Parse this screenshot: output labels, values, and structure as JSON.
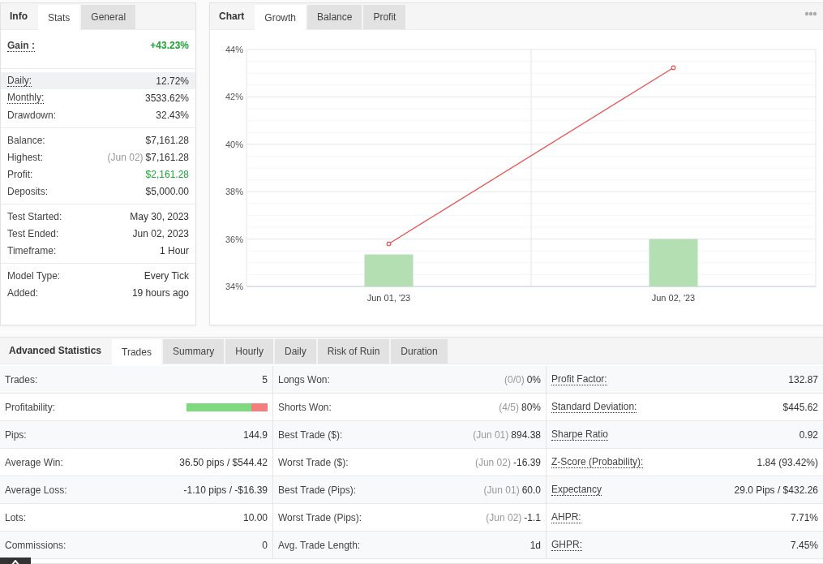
{
  "stats_panel": {
    "header": "Info",
    "tabs": [
      {
        "label": "Stats",
        "selected": true
      },
      {
        "label": "General",
        "selected": false
      }
    ],
    "groups": [
      {
        "rows": [
          {
            "label": "Gain :",
            "value": "+43.23%",
            "positive": true,
            "underlined": true,
            "highlighted": false,
            "bold": true
          }
        ]
      },
      {
        "rows": [
          {
            "label": "Daily:",
            "value": "12.72%",
            "positive": false,
            "underlined": true,
            "highlighted": true,
            "bold": false
          },
          {
            "label": "Monthly:",
            "value": "3533.62%",
            "positive": false,
            "underlined": true,
            "highlighted": false,
            "bold": false
          },
          {
            "label": "Drawdown:",
            "value": "32.43%",
            "positive": false,
            "underlined": false,
            "highlighted": false,
            "bold": false
          }
        ]
      },
      {
        "rows": [
          {
            "label": "Balance:",
            "value": "$7,161.28",
            "positive": false,
            "underlined": false,
            "highlighted": false,
            "bold": false
          },
          {
            "label": "Highest:",
            "note": "(Jun 02)",
            "value": "$7,161.28",
            "positive": false,
            "underlined": false,
            "highlighted": false,
            "bold": false
          },
          {
            "label": "Profit:",
            "value": "$2,161.28",
            "positive": true,
            "underlined": false,
            "highlighted": false,
            "bold": false
          },
          {
            "label": "Deposits:",
            "value": "$5,000.00",
            "positive": false,
            "underlined": false,
            "highlighted": false,
            "bold": false
          }
        ]
      },
      {
        "rows": [
          {
            "label": "Test Started:",
            "value": "May 30, 2023",
            "positive": false,
            "underlined": false,
            "highlighted": false,
            "bold": false
          },
          {
            "label": "Test Ended:",
            "value": "Jun 02, 2023",
            "positive": false,
            "underlined": false,
            "highlighted": false,
            "bold": false
          },
          {
            "label": "Timeframe:",
            "value": "1 Hour",
            "positive": false,
            "underlined": false,
            "highlighted": false,
            "bold": false
          }
        ]
      },
      {
        "rows": [
          {
            "label": "Model Type:",
            "value": "Every Tick",
            "positive": false,
            "underlined": false,
            "highlighted": false,
            "bold": false
          },
          {
            "label": "Added:",
            "value": "19 hours ago",
            "positive": false,
            "underlined": false,
            "highlighted": false,
            "bold": false
          }
        ]
      }
    ]
  },
  "chart_panel": {
    "header": "Chart",
    "tabs": [
      {
        "label": "Growth",
        "selected": true
      },
      {
        "label": "Balance",
        "selected": false
      },
      {
        "label": "Profit",
        "selected": false
      }
    ],
    "chart_data": {
      "type": "bar",
      "grid": true,
      "categories": [
        "Jun 01, '23",
        "Jun 02, '23"
      ],
      "ylim": [
        34,
        44
      ],
      "yticks": [
        {
          "value": 34,
          "label": "34%"
        },
        {
          "value": 36,
          "label": "36%"
        },
        {
          "value": 38,
          "label": "38%"
        },
        {
          "value": 40,
          "label": "40%"
        },
        {
          "value": 42,
          "label": "42%"
        },
        {
          "value": 44,
          "label": "44%"
        }
      ],
      "series": [
        {
          "type": "bar",
          "color": "#b3dfb3",
          "values": [
            35.35,
            36.0
          ]
        },
        {
          "type": "line",
          "color": "#e8514f",
          "marker": "circle",
          "values": [
            35.8,
            43.23
          ]
        }
      ]
    }
  },
  "advanced": {
    "header": "Advanced Statistics",
    "tabs": [
      {
        "label": "Trades",
        "selected": true
      },
      {
        "label": "Summary",
        "selected": false
      },
      {
        "label": "Hourly",
        "selected": false
      },
      {
        "label": "Daily",
        "selected": false
      },
      {
        "label": "Risk of Ruin",
        "selected": false
      },
      {
        "label": "Duration",
        "selected": false
      }
    ],
    "columns": [
      {
        "underlined": false,
        "rows": [
          {
            "kind": "text",
            "label": "Trades:",
            "value": "5"
          },
          {
            "kind": "bar",
            "label": "Profitability:",
            "level": 0.8
          },
          {
            "kind": "text",
            "label": "Pips:",
            "value": "144.9"
          },
          {
            "kind": "text",
            "label": "Average Win:",
            "value": "36.50 pips / $544.42"
          },
          {
            "kind": "text",
            "label": "Average Loss:",
            "value": "-1.10 pips / -$16.39"
          },
          {
            "kind": "text",
            "label": "Lots:",
            "value": "10.00"
          },
          {
            "kind": "text",
            "label": "Commissions:",
            "value": "0"
          }
        ]
      },
      {
        "underlined": false,
        "rows": [
          {
            "kind": "text",
            "label": "Longs Won:",
            "note": "(0/0)",
            "value": "0%"
          },
          {
            "kind": "text",
            "label": "Shorts Won:",
            "note": "(4/5)",
            "value": "80%"
          },
          {
            "kind": "text",
            "label": "Best Trade ($):",
            "note": "(Jun 01)",
            "value": "894.38"
          },
          {
            "kind": "text",
            "label": "Worst Trade ($):",
            "note": "(Jun 02)",
            "value": "-16.39"
          },
          {
            "kind": "text",
            "label": "Best Trade (Pips):",
            "note": "(Jun 01)",
            "value": "60.0"
          },
          {
            "kind": "text",
            "label": "Worst Trade (Pips):",
            "note": "(Jun 02)",
            "value": "-1.1"
          },
          {
            "kind": "text",
            "label": "Avg. Trade Length:",
            "value": "1d"
          }
        ]
      },
      {
        "underlined": true,
        "rows": [
          {
            "kind": "text",
            "label": "Profit Factor:",
            "value": "132.87"
          },
          {
            "kind": "text",
            "label": "Standard Deviation:",
            "value": "$445.62"
          },
          {
            "kind": "text",
            "label": "Sharpe Ratio",
            "value": "0.92"
          },
          {
            "kind": "text",
            "label": "Z-Score (Probability):",
            "value": "1.84 (93.42%)"
          },
          {
            "kind": "text",
            "label": "Expectancy",
            "value": "29.0 Pips / $432.26"
          },
          {
            "kind": "text",
            "label": "AHPR:",
            "value": "7.71%"
          },
          {
            "kind": "text",
            "label": "GHPR:",
            "value": "7.45%"
          }
        ]
      }
    ]
  }
}
